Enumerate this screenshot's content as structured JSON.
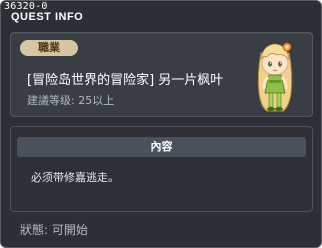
{
  "window": {
    "quest_id": "36320-0",
    "title": "QUEST INFO"
  },
  "quest": {
    "category": "職業",
    "name": "[冒险岛世界的冒险家] 另一片枫叶",
    "level_requirement": "建議等级: 25以上",
    "npc_icon": "blonde-girl-npc-icon"
  },
  "content": {
    "header": "內容",
    "text": "必须带修嘉逃走。"
  },
  "status": {
    "text": "狀態: 可開始"
  },
  "colors": {
    "window_bg": "#2c3036",
    "badge_bg": "#d8c6a3",
    "header_bg": "#4a535d"
  }
}
